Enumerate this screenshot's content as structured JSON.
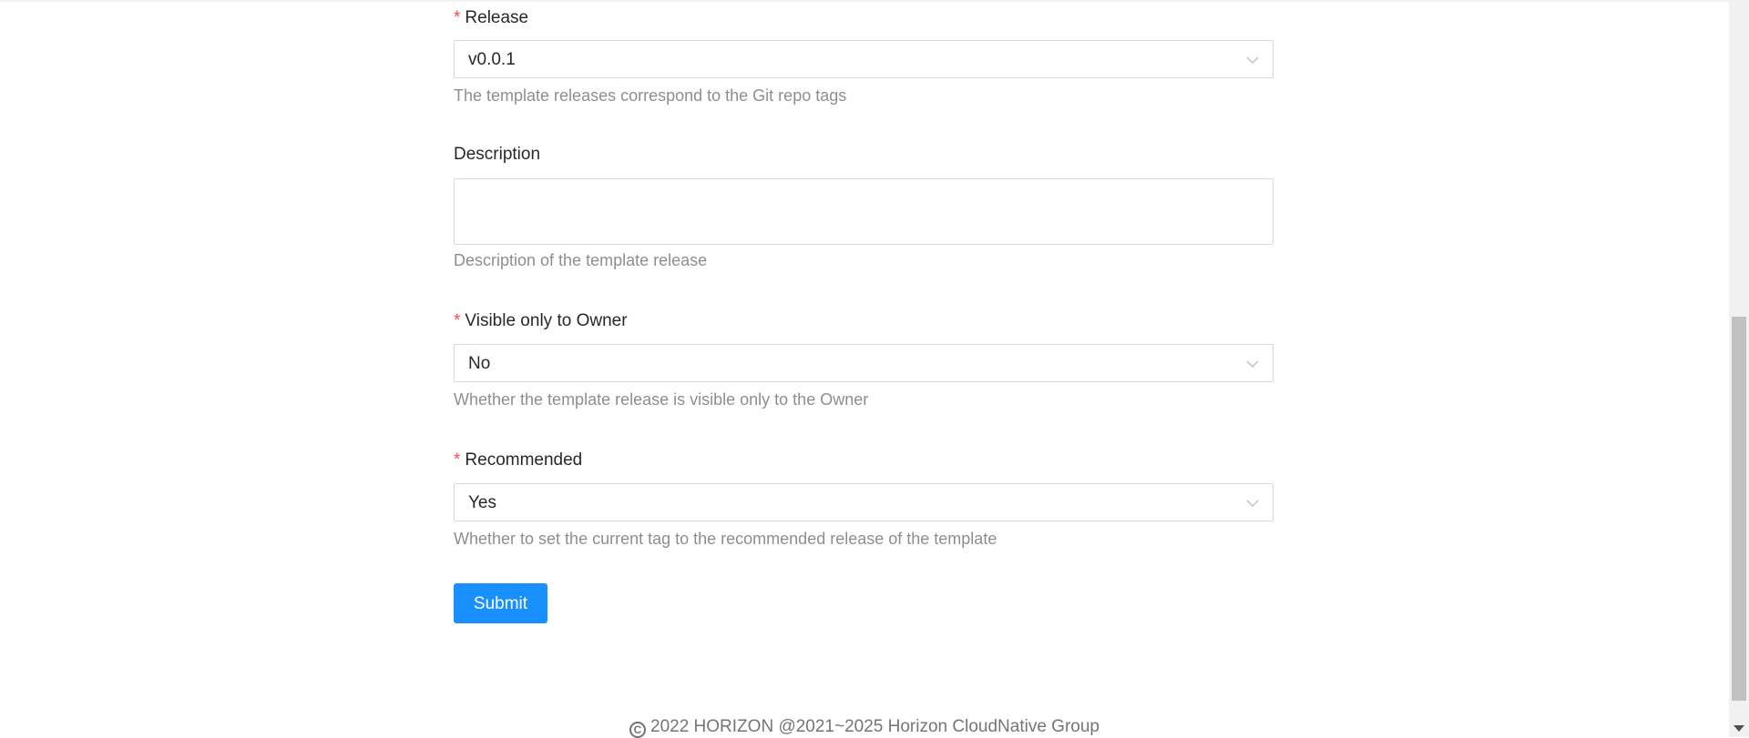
{
  "form": {
    "release": {
      "label": "Release",
      "value": "v0.0.1",
      "help": "The template releases correspond to the Git repo tags"
    },
    "description": {
      "label": "Description",
      "value": "",
      "help": "Description of the template release"
    },
    "visible_only_owner": {
      "label": "Visible only to Owner",
      "value": "No",
      "help": "Whether the template release is visible only to the Owner"
    },
    "recommended": {
      "label": "Recommended",
      "value": "Yes",
      "help": "Whether to set the current tag to the recommended release of the template"
    },
    "required_mark": "*",
    "submit_label": "Submit"
  },
  "footer": {
    "copyright_symbol": "C",
    "text": "2022 HORIZON @2021~2025 Horizon CloudNative Group"
  },
  "colors": {
    "primary": "#1890ff",
    "required": "#ff4d4f",
    "border": "#d9d9d9"
  },
  "icons": {
    "select_arrow": "chevron-down-icon",
    "copyright": "copyright-icon",
    "scroll_down": "scroll-down-arrow-icon"
  }
}
